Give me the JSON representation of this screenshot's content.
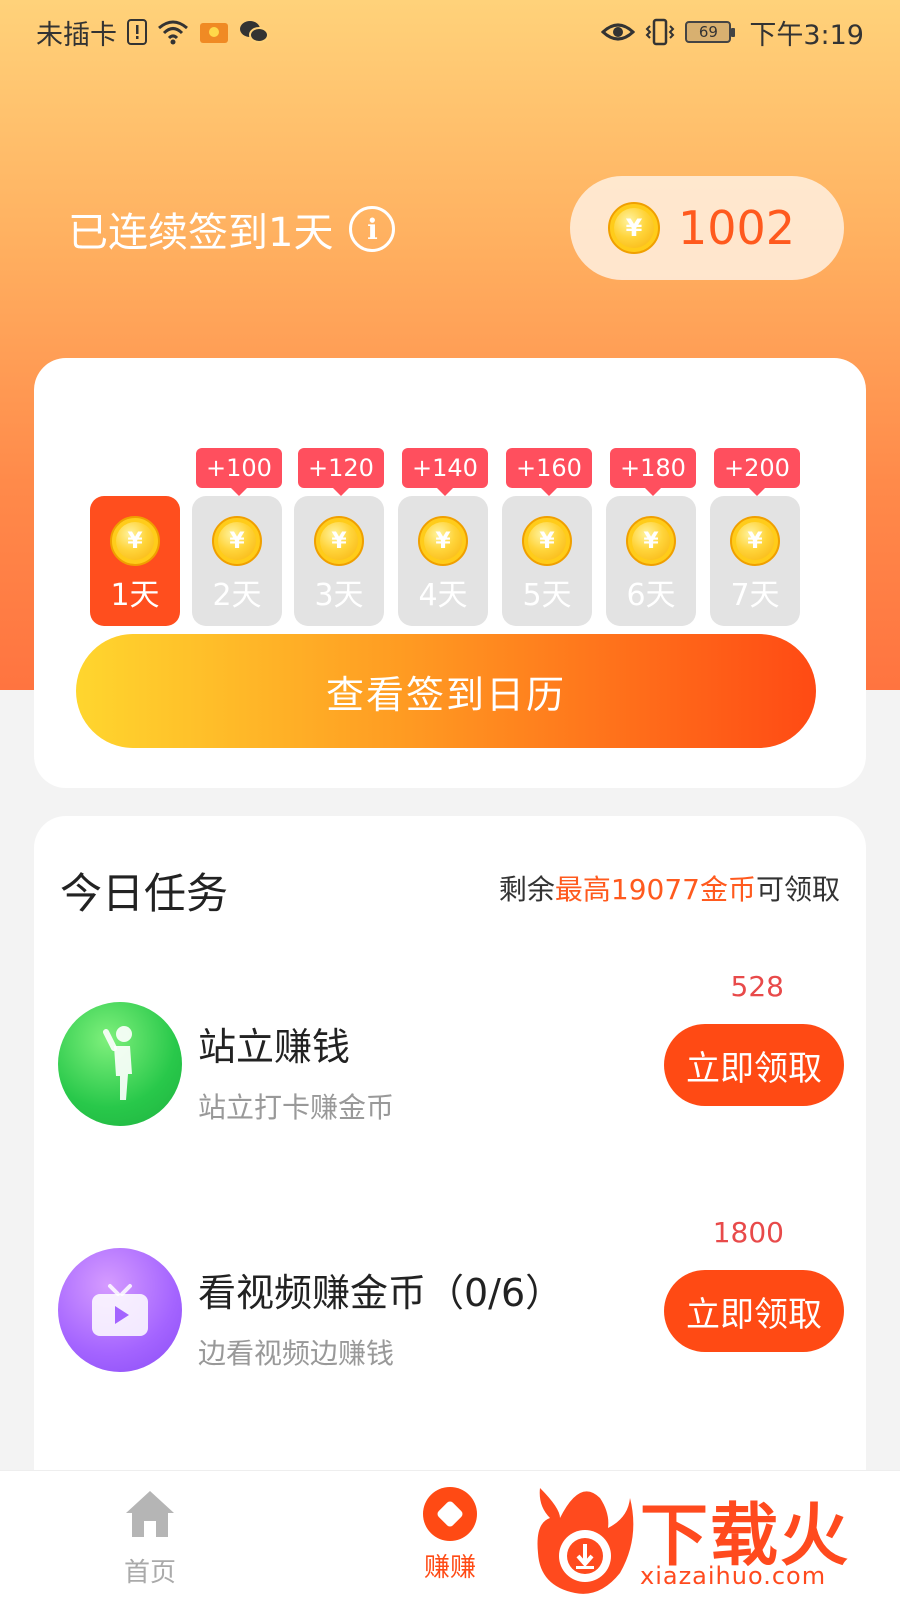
{
  "status_bar": {
    "carrier": "未插卡",
    "battery": "69",
    "time": "下午3:19"
  },
  "header": {
    "streak_text": "已连续签到1天",
    "balance": "1002"
  },
  "signin": {
    "coin_symbol": "¥",
    "days": [
      {
        "label": "1天",
        "bonus": "",
        "active": true
      },
      {
        "label": "2天",
        "bonus": "+100",
        "active": false
      },
      {
        "label": "3天",
        "bonus": "+120",
        "active": false
      },
      {
        "label": "4天",
        "bonus": "+140",
        "active": false
      },
      {
        "label": "5天",
        "bonus": "+160",
        "active": false
      },
      {
        "label": "6天",
        "bonus": "+180",
        "active": false
      },
      {
        "label": "7天",
        "bonus": "+200",
        "active": false
      }
    ],
    "calendar_button": "查看签到日历"
  },
  "tasks": {
    "title": "今日任务",
    "remaining_prefix": "剩余",
    "remaining_highlight": "最高19077金币",
    "remaining_suffix": "可领取",
    "items": [
      {
        "name": "站立赚钱",
        "desc": "站立打卡赚金币",
        "reward": "528",
        "button": "立即领取",
        "icon": "standing-person-icon"
      },
      {
        "name": "看视频赚金币（0/6）",
        "desc": "边看视频边赚钱",
        "reward": "1800",
        "button": "立即领取",
        "icon": "tv-play-icon"
      }
    ]
  },
  "bottom_nav": {
    "home_label": "首页",
    "earn_label": "赚赚"
  },
  "watermark": {
    "text": "下载火",
    "url": "xiazaihuo.com"
  },
  "colors": {
    "accent": "#ff4a14",
    "reward_red": "#e84a4a",
    "bonus_badge": "#ff4f5e"
  }
}
